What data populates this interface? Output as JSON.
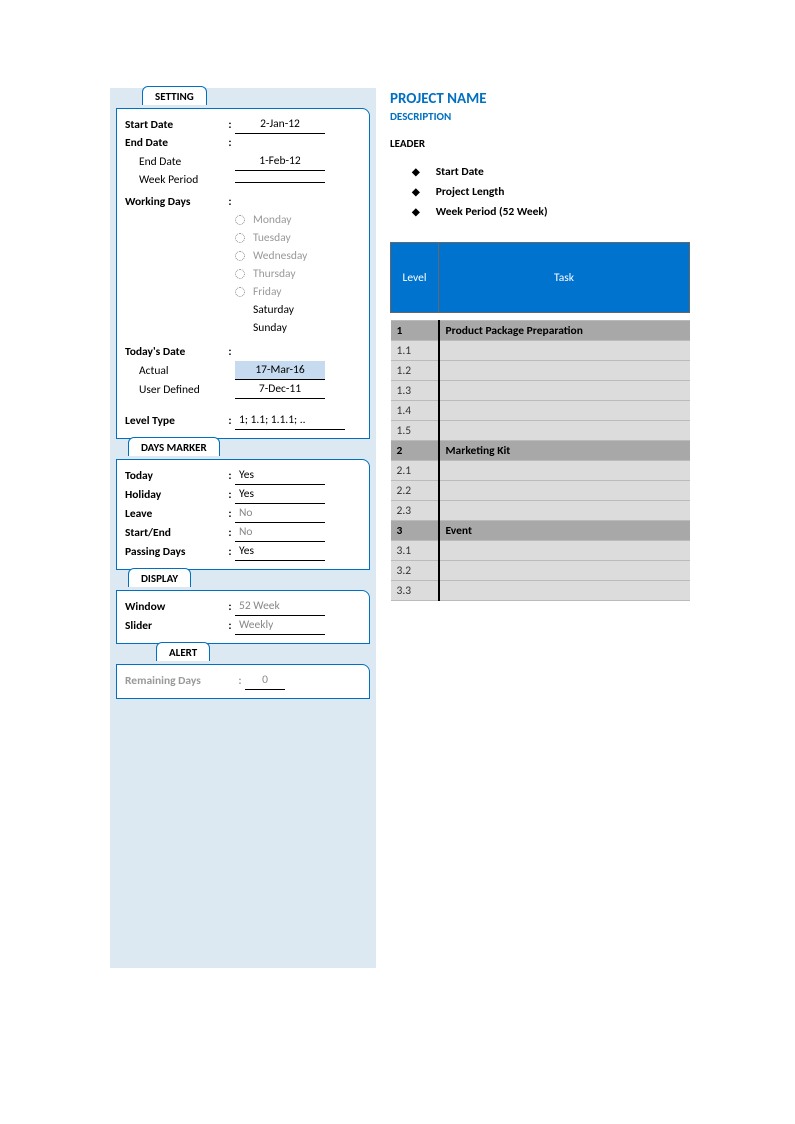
{
  "sidebar": {
    "setting": {
      "tab": "SETTING",
      "start_date_label": "Start Date",
      "start_date_value": "2-Jan-12",
      "end_date_label": "End Date",
      "end_date_sub_label": "End Date",
      "end_date_value": "1-Feb-12",
      "week_period_label": "Week Period",
      "week_period_value": "",
      "working_days_label": "Working Days",
      "days": {
        "mon": "Monday",
        "tue": "Tuesday",
        "wed": "Wednesday",
        "thu": "Thursday",
        "fri": "Friday",
        "sat": "Saturday",
        "sun": "Sunday"
      },
      "todays_date_label": "Today's Date",
      "actual_label": "Actual",
      "actual_value": "17-Mar-16",
      "user_defined_label": "User Defined",
      "user_defined_value": "7-Dec-11",
      "level_type_label": "Level Type",
      "level_type_value": "1; 1.1; 1.1.1; .."
    },
    "days_marker": {
      "tab": "DAYS MARKER",
      "today_label": "Today",
      "today_value": "Yes",
      "holiday_label": "Holiday",
      "holiday_value": "Yes",
      "leave_label": "Leave",
      "leave_value": "No",
      "startend_label": "Start/End",
      "startend_value": "No",
      "passing_label": "Passing Days",
      "passing_value": "Yes"
    },
    "display": {
      "tab": "DISPLAY",
      "window_label": "Window",
      "window_value": "52 Week",
      "slider_label": "Slider",
      "slider_value": "Weekly"
    },
    "alert": {
      "tab": "ALERT",
      "remaining_label": "Remaining Days",
      "remaining_value": "0"
    }
  },
  "main": {
    "project_name": "PROJECT NAME",
    "description": "DESCRIPTION",
    "leader": "LEADER",
    "bullets": {
      "b1": "Start Date",
      "b2": "Project Length",
      "b3": "Week Period (52 Week)"
    },
    "table": {
      "level_header": "Level",
      "task_header": "Task",
      "rows": [
        {
          "level": "1",
          "task": "Product Package Preparation",
          "group": true
        },
        {
          "level": "1.1",
          "task": "",
          "group": false
        },
        {
          "level": "1.2",
          "task": "",
          "group": false
        },
        {
          "level": "1.3",
          "task": "",
          "group": false
        },
        {
          "level": "1.4",
          "task": "",
          "group": false
        },
        {
          "level": "1.5",
          "task": "",
          "group": false
        },
        {
          "level": "2",
          "task": "Marketing Kit",
          "group": true
        },
        {
          "level": "2.1",
          "task": "",
          "group": false
        },
        {
          "level": "2.2",
          "task": "",
          "group": false
        },
        {
          "level": "2.3",
          "task": "",
          "group": false
        },
        {
          "level": "3",
          "task": "Event",
          "group": true
        },
        {
          "level": "3.1",
          "task": "",
          "group": false
        },
        {
          "level": "3.2",
          "task": "",
          "group": false
        },
        {
          "level": "3.3",
          "task": "",
          "group": false
        }
      ]
    }
  }
}
